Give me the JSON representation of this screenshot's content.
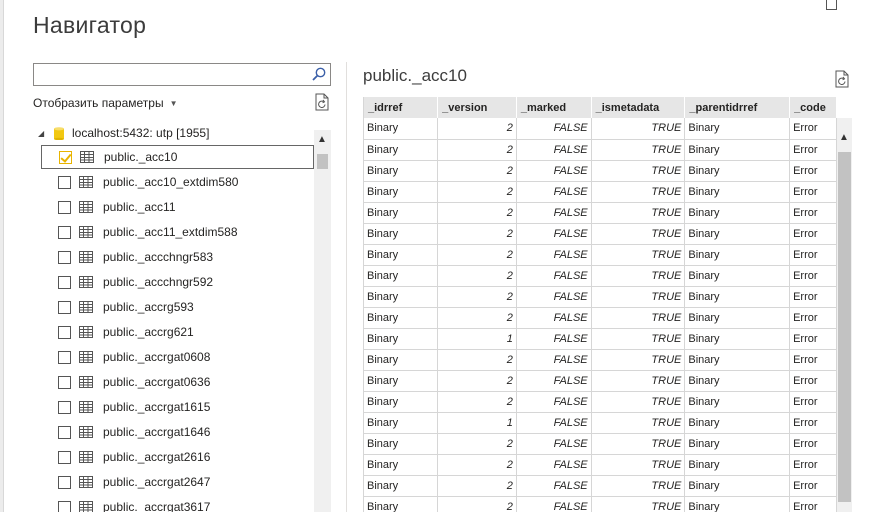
{
  "window": {
    "title": "Навигатор"
  },
  "search": {
    "value": "",
    "placeholder": ""
  },
  "options": {
    "label": "Отобразить параметры"
  },
  "tree": {
    "root_label": "localhost:5432: utp [1955]",
    "items": [
      {
        "label": "public._acc10",
        "checked": true
      },
      {
        "label": "public._acc10_extdim580",
        "checked": false
      },
      {
        "label": "public._acc11",
        "checked": false
      },
      {
        "label": "public._acc11_extdim588",
        "checked": false
      },
      {
        "label": "public._accchngr583",
        "checked": false
      },
      {
        "label": "public._accchngr592",
        "checked": false
      },
      {
        "label": "public._accrg593",
        "checked": false
      },
      {
        "label": "public._accrg621",
        "checked": false
      },
      {
        "label": "public._accrgat0608",
        "checked": false
      },
      {
        "label": "public._accrgat0636",
        "checked": false
      },
      {
        "label": "public._accrgat1615",
        "checked": false
      },
      {
        "label": "public._accrgat1646",
        "checked": false
      },
      {
        "label": "public._accrgat2616",
        "checked": false
      },
      {
        "label": "public._accrgat2647",
        "checked": false
      },
      {
        "label": "public._accrgat3617",
        "checked": false
      }
    ]
  },
  "preview": {
    "title": "public._acc10",
    "columns": [
      "_idrref",
      "_version",
      "_marked",
      "_ismetadata",
      "_parentidrref",
      "_code"
    ],
    "rows": [
      [
        "Binary",
        "2",
        "FALSE",
        "TRUE",
        "Binary",
        "Error"
      ],
      [
        "Binary",
        "2",
        "FALSE",
        "TRUE",
        "Binary",
        "Error"
      ],
      [
        "Binary",
        "2",
        "FALSE",
        "TRUE",
        "Binary",
        "Error"
      ],
      [
        "Binary",
        "2",
        "FALSE",
        "TRUE",
        "Binary",
        "Error"
      ],
      [
        "Binary",
        "2",
        "FALSE",
        "TRUE",
        "Binary",
        "Error"
      ],
      [
        "Binary",
        "2",
        "FALSE",
        "TRUE",
        "Binary",
        "Error"
      ],
      [
        "Binary",
        "2",
        "FALSE",
        "TRUE",
        "Binary",
        "Error"
      ],
      [
        "Binary",
        "2",
        "FALSE",
        "TRUE",
        "Binary",
        "Error"
      ],
      [
        "Binary",
        "2",
        "FALSE",
        "TRUE",
        "Binary",
        "Error"
      ],
      [
        "Binary",
        "2",
        "FALSE",
        "TRUE",
        "Binary",
        "Error"
      ],
      [
        "Binary",
        "1",
        "FALSE",
        "TRUE",
        "Binary",
        "Error"
      ],
      [
        "Binary",
        "2",
        "FALSE",
        "TRUE",
        "Binary",
        "Error"
      ],
      [
        "Binary",
        "2",
        "FALSE",
        "TRUE",
        "Binary",
        "Error"
      ],
      [
        "Binary",
        "2",
        "FALSE",
        "TRUE",
        "Binary",
        "Error"
      ],
      [
        "Binary",
        "1",
        "FALSE",
        "TRUE",
        "Binary",
        "Error"
      ],
      [
        "Binary",
        "2",
        "FALSE",
        "TRUE",
        "Binary",
        "Error"
      ],
      [
        "Binary",
        "2",
        "FALSE",
        "TRUE",
        "Binary",
        "Error"
      ],
      [
        "Binary",
        "2",
        "FALSE",
        "TRUE",
        "Binary",
        "Error"
      ],
      [
        "Binary",
        "2",
        "FALSE",
        "TRUE",
        "Binary",
        "Error"
      ]
    ]
  },
  "icons": {
    "search": "search-icon",
    "refresh": "refresh-icon",
    "database": "database-icon",
    "table": "table-icon",
    "checkbox_accent": "#e8b400"
  }
}
